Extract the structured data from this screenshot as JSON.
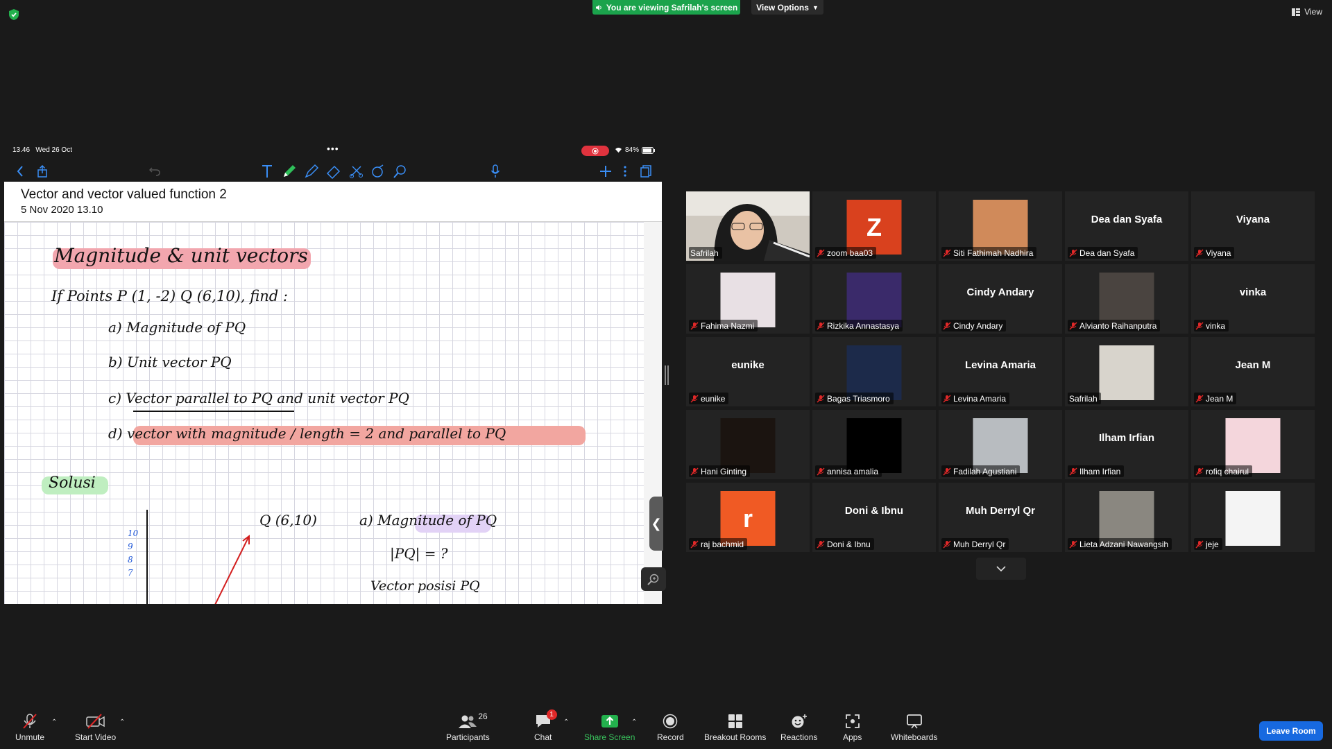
{
  "top": {
    "banner": "You are viewing Safrilah's screen",
    "view_options": "View Options",
    "view": "View"
  },
  "shared": {
    "status_time": "13.46",
    "status_date": "Wed 26 Oct",
    "battery": "84%",
    "note_title": "Vector and vector valued function 2",
    "note_date": "5 Nov 2020 13.10",
    "handwriting": {
      "heading": "Magnitude & unit vectors",
      "question": "If Points P (1, -2) Q (6,10), find :",
      "item_a": "a) Magnitude of PQ",
      "item_b": "b) Unit vector PQ",
      "item_c": "c) Vector parallel to PQ and unit vector PQ",
      "item_d": "d) vector with magnitude / length = 2 and parallel to PQ",
      "solusi": "Solusi",
      "point_q": "Q (6,10)",
      "sol_a": "a) Magnitude of PQ",
      "sol_abs": "|PQ| = ?",
      "sol_pos": "Vector posisi PQ",
      "axis_ticks": [
        "10",
        "9",
        "8",
        "7"
      ]
    }
  },
  "participants": [
    {
      "name": "Safrilah",
      "kind": "video",
      "bg": "#c9c2b8",
      "active": true,
      "muted": false
    },
    {
      "name": "zoom baa03",
      "kind": "letter",
      "letter": "Z",
      "bg": "#d9411e",
      "muted": true
    },
    {
      "name": "Siti Fathimah Nadhira",
      "kind": "pic",
      "bg": "#d08a5a",
      "muted": true
    },
    {
      "name": "Dea dan Syafa",
      "kind": "text",
      "display": "Dea dan Syafa",
      "muted": true
    },
    {
      "name": "Viyana",
      "kind": "text",
      "display": "Viyana",
      "muted": true
    },
    {
      "name": "Fahima Nazmi",
      "kind": "pic",
      "bg": "#e8e0e4",
      "muted": true
    },
    {
      "name": "Rizkika Annastasya",
      "kind": "pic",
      "bg": "#3a2a6a",
      "muted": true
    },
    {
      "name": "Cindy Andary",
      "kind": "text",
      "display": "Cindy Andary",
      "muted": true
    },
    {
      "name": "Alvianto Raihanputra",
      "kind": "pic",
      "bg": "#4a4440",
      "muted": true
    },
    {
      "name": "vinka",
      "kind": "text",
      "display": "vinka",
      "muted": true
    },
    {
      "name": "eunike",
      "kind": "text",
      "display": "eunike",
      "muted": true
    },
    {
      "name": "Bagas Triasmoro",
      "kind": "pic",
      "bg": "#1c2a4a",
      "muted": true
    },
    {
      "name": "Levina Amaria",
      "kind": "text",
      "display": "Levina Amaria",
      "muted": true
    },
    {
      "name": "Safrilah",
      "kind": "pic",
      "bg": "#d8d4cc",
      "muted": false
    },
    {
      "name": "Jean M",
      "kind": "text",
      "display": "Jean M",
      "muted": true
    },
    {
      "name": "Hani Ginting",
      "kind": "pic",
      "bg": "#1b1410",
      "muted": true
    },
    {
      "name": "annisa amalia",
      "kind": "pic",
      "bg": "#000000",
      "muted": true
    },
    {
      "name": "Fadilah Agustiani",
      "kind": "pic",
      "bg": "#b8bcc0",
      "muted": true
    },
    {
      "name": "Ilham Irfian",
      "kind": "text",
      "display": "Ilham Irfian",
      "muted": true
    },
    {
      "name": "rofiq chairul",
      "kind": "pic",
      "bg": "#f4d6dc",
      "muted": true
    },
    {
      "name": "raj bachmid",
      "kind": "letter",
      "letter": "r",
      "bg": "#f05a24",
      "muted": true
    },
    {
      "name": "Doni & Ibnu",
      "kind": "text",
      "display": "Doni & Ibnu",
      "muted": true
    },
    {
      "name": "Muh Derryl Qr",
      "kind": "text",
      "display": "Muh Derryl Qr",
      "muted": true
    },
    {
      "name": "Lieta Adzani Nawangsih",
      "kind": "pic",
      "bg": "#8a8780",
      "muted": true
    },
    {
      "name": "jeje",
      "kind": "pic",
      "bg": "#f4f4f4",
      "muted": true
    }
  ],
  "controls": {
    "unmute": "Unmute",
    "start_video": "Start Video",
    "participants": "Participants",
    "participants_count": "26",
    "chat": "Chat",
    "chat_badge": "1",
    "share_screen": "Share Screen",
    "record": "Record",
    "breakout_rooms": "Breakout Rooms",
    "reactions": "Reactions",
    "apps": "Apps",
    "whiteboards": "Whiteboards",
    "leave_room": "Leave Room"
  }
}
